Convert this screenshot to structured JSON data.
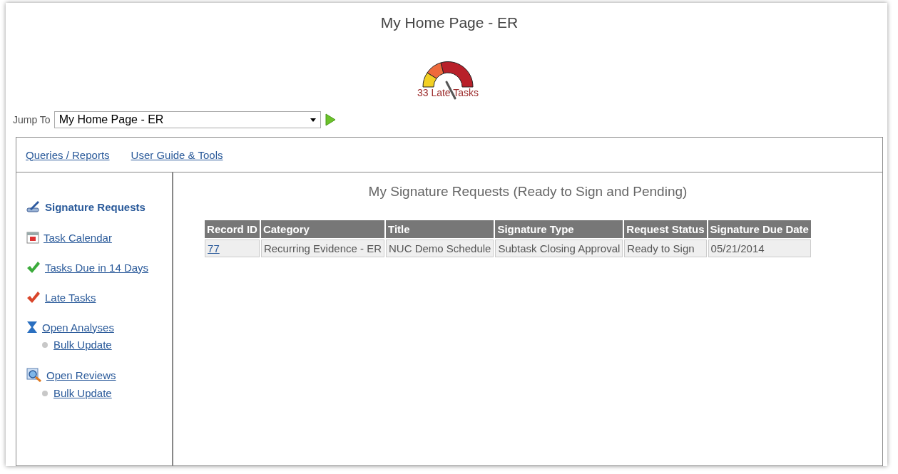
{
  "page_title": "My Home Page - ER",
  "gauge": {
    "label": "33 Late Tasks"
  },
  "jump_to": {
    "label": "Jump To",
    "value": "My Home Page - ER"
  },
  "top_links": [
    "Queries / Reports",
    "User Guide & Tools"
  ],
  "sidebar": {
    "items": [
      {
        "label": "Signature Requests",
        "selected": true
      },
      {
        "label": "Task Calendar",
        "selected": false
      },
      {
        "label": "Tasks Due in 14 Days",
        "selected": false
      },
      {
        "label": "Late Tasks",
        "selected": false
      },
      {
        "label": "Open Analyses",
        "selected": false,
        "children": [
          {
            "label": "Bulk Update"
          }
        ]
      },
      {
        "label": "Open Reviews",
        "selected": false,
        "children": [
          {
            "label": "Bulk Update"
          }
        ]
      }
    ]
  },
  "panel": {
    "title": "My Signature Requests (Ready to Sign and Pending)",
    "table": {
      "columns": [
        "Record ID",
        "Category",
        "Title",
        "Signature Type",
        "Request Status",
        "Signature Due Date"
      ],
      "rows": [
        [
          "77",
          "Recurring Evidence - ER",
          "NUC Demo Schedule",
          "Subtask Closing Approval",
          "Ready to Sign",
          "05/21/2014"
        ]
      ]
    }
  }
}
